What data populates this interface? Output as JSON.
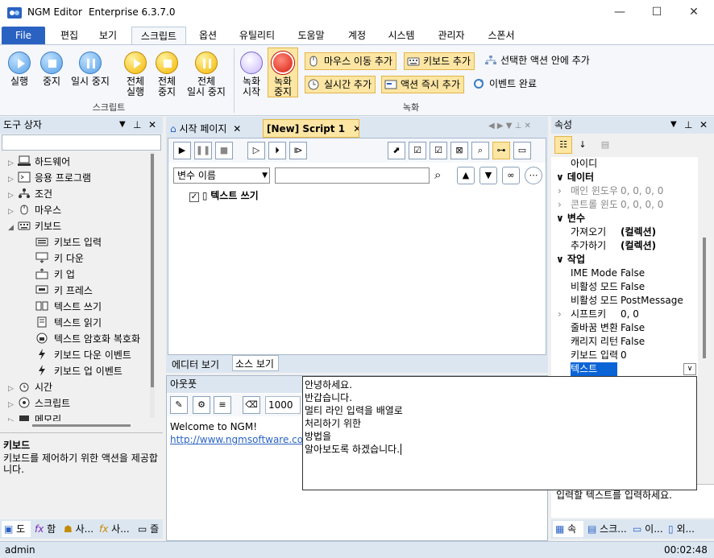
{
  "window": {
    "app": "NGM Editor",
    "edition": "Enterprise 6.3.7.0",
    "min": "—",
    "max": "☐",
    "close": "✕"
  },
  "menu": {
    "file": "File",
    "tabs": [
      "편집",
      "보기",
      "스크립트",
      "옵션",
      "유틸리티",
      "도움말",
      "계정",
      "시스템",
      "관리자",
      "스폰서"
    ]
  },
  "ribbon": {
    "script_group": "스크립트",
    "run": "실행",
    "stop": "중지",
    "pause": "일시 중지",
    "all_run_1": "전체",
    "all_run_2": "실행",
    "all_stop_1": "전체",
    "all_stop_2": "중지",
    "all_pause_1": "전체",
    "all_pause_2": "일시 중지",
    "record_group": "녹화",
    "rec_start_1": "녹화",
    "rec_start_2": "시작",
    "rec_stop_1": "녹화",
    "rec_stop_2": "중지",
    "add_mouse": "마우스 이동 추가",
    "add_keyboard": "키보드 추가",
    "add_in_action": "선택한 액션 안에 추가",
    "add_realtime": "실시간 추가",
    "add_instant": "액션 즉시 추가",
    "event_done": "이벤트 완료"
  },
  "toolbox": {
    "title": "도구 상자",
    "items": [
      "하드웨어",
      "응용 프로그램",
      "조건",
      "마우스",
      "키보드"
    ],
    "keyboard_children": [
      "키보드 입력",
      "키 다운",
      "키 업",
      "키 프레스",
      "텍스트 쓰기",
      "텍스트 읽기",
      "텍스트 암호화 복호화",
      "키보드 다운 이벤트",
      "키보드 업 이벤트"
    ],
    "after": [
      "시간",
      "스크립트",
      "메모리"
    ],
    "desc_title": "키보드",
    "desc_text": "키보드를 제어하기 위한 액션을 제공합니다.",
    "tabs": [
      "도",
      "함",
      "사...",
      "사...",
      "즐"
    ]
  },
  "editor": {
    "tab_start": "시작 페이지",
    "tab_script": "[New] Script 1",
    "var_select": "변수 이름",
    "var_value": "",
    "action_label": "텍스트 쓰기",
    "view_editor": "에디터 보기",
    "view_source": "소스 보기"
  },
  "output": {
    "title": "아웃풋",
    "count": "1000",
    "line1": "Welcome to NGM!",
    "line2": "http://www.ngmsoftware.com"
  },
  "popup": {
    "lines": [
      "안녕하세요.",
      "반갑습니다.",
      "멀티 라인 입력을 배열로",
      "처리하기 위한",
      "방법을",
      "알아보도록 하겠습니다."
    ]
  },
  "props": {
    "title": "속성",
    "top_row": "아이디",
    "cat_data": "데이터",
    "rows_data": [
      {
        "n": "매인 윈도우",
        "v": "0, 0, 0, 0"
      },
      {
        "n": "콘트롤 윈도우",
        "v": "0, 0, 0, 0"
      }
    ],
    "cat_var": "변수",
    "rows_var": [
      {
        "n": "가져오기",
        "v": "(컬렉션)"
      },
      {
        "n": "추가하기",
        "v": "(컬렉션)"
      }
    ],
    "cat_work": "작업",
    "rows_work": [
      {
        "n": "IME Mode",
        "v": "False"
      },
      {
        "n": "비활성 모드",
        "v": "False"
      },
      {
        "n": "비활성 모드",
        "v": "PostMessage"
      },
      {
        "n": "시프트키",
        "v": "0, 0"
      },
      {
        "n": "줄바꿈 변환",
        "v": "False"
      },
      {
        "n": "캐리지 리턴",
        "v": "False"
      },
      {
        "n": "키보드 입력",
        "v": "0"
      }
    ],
    "selected": "텍스트",
    "desc": "입력할 텍스트를 입력하세요.",
    "tabs": [
      "속",
      "스크...",
      "이...",
      "외..."
    ]
  },
  "status": {
    "user": "admin",
    "time": "00:02:48"
  }
}
